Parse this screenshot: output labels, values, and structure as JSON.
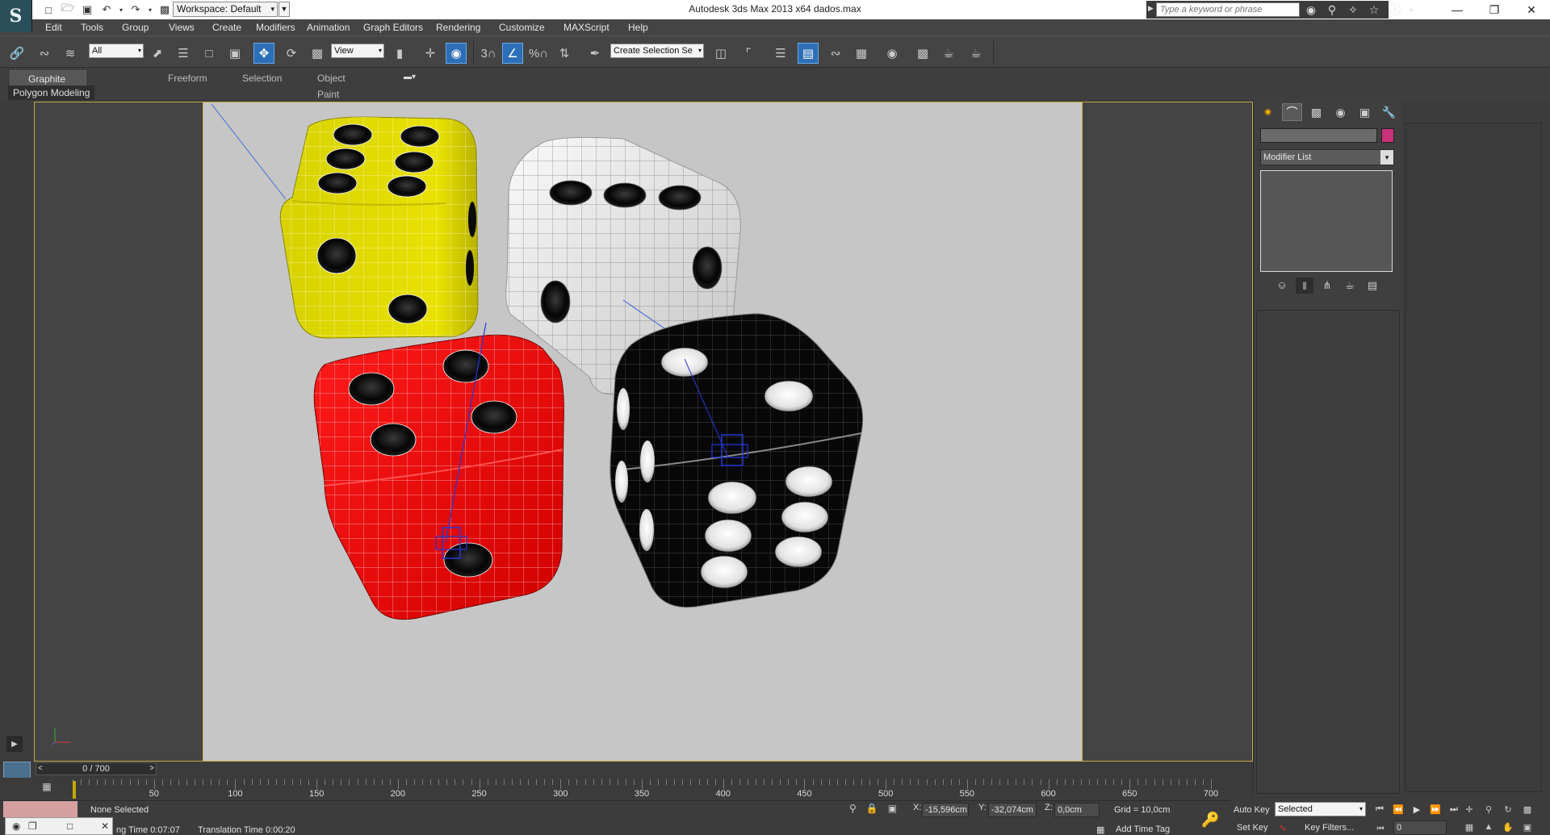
{
  "titlebar": {
    "logo": "S",
    "workspace": "Workspace: Default",
    "window_title": "Autodesk 3ds Max  2013 x64      dados.max",
    "search_placeholder": "Type a keyword or phrase",
    "icons": [
      "new-file-icon",
      "open-file-icon",
      "save-icon",
      "undo-icon",
      "redo-icon",
      "project-folder-icon"
    ]
  },
  "menu": [
    "Edit",
    "Tools",
    "Group",
    "Views",
    "Create",
    "Modifiers",
    "Animation",
    "Graph Editors",
    "Rendering",
    "Customize",
    "MAXScript",
    "Help"
  ],
  "toolbar": {
    "selection_filter": "All",
    "reference_coord": "View",
    "snap_label": "3",
    "percent_snap_label": "%",
    "named_selection": "Create Selection Se"
  },
  "ribbon": {
    "tabs": [
      "Graphite Modeling Tools",
      "Freeform",
      "Selection",
      "Object Paint"
    ],
    "panel_label": "Polygon Modeling"
  },
  "scene": {
    "dice": [
      {
        "name": "yellow-die",
        "color": "#e6df00"
      },
      {
        "name": "white-die",
        "color": "#f4f4f4"
      },
      {
        "name": "red-die",
        "color": "#f50000"
      },
      {
        "name": "black-die",
        "color": "#0a0a0a"
      }
    ],
    "background": "#c6c6c6"
  },
  "command_panel": {
    "modifier_list": "Modifier List",
    "object_color": "#c8327a"
  },
  "timeline": {
    "frame_display": "0 / 700",
    "ticks": [
      "50",
      "100",
      "150",
      "200",
      "250",
      "300",
      "350",
      "400",
      "450",
      "500",
      "550",
      "600",
      "650",
      "700"
    ]
  },
  "status": {
    "selection": "None Selected",
    "x_label": "X:",
    "x_value": "-15,596cm",
    "y_label": "Y:",
    "y_value": "-32,074cm",
    "z_label": "Z:",
    "z_value": "0,0cm",
    "grid": "Grid = 10,0cm",
    "render_time": "ng Time  0:07:07",
    "translation_time": "Translation Time  0:00:20",
    "add_time_tag": "Add Time Tag"
  },
  "animation": {
    "auto_key": "Auto Key",
    "selected": "Selected",
    "set_key": "Set Key",
    "key_filters": "Key Filters...",
    "frame": "0"
  }
}
